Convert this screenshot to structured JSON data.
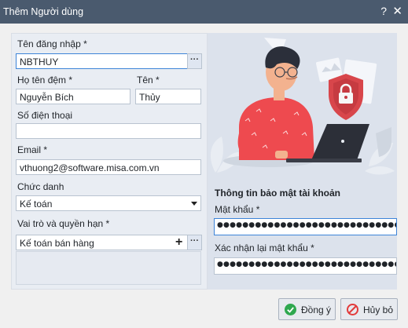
{
  "window": {
    "title": "Thêm Người dùng",
    "help_glyph": "?",
    "close_glyph": "✕"
  },
  "form": {
    "username_label": "Tên đăng nhập *",
    "username_value": "NBTHUY",
    "lastname_label": "Họ tên đệm *",
    "lastname_value": "Nguyễn Bích",
    "firstname_label": "Tên *",
    "firstname_value": "Thủy",
    "phone_label": "Số điện thoại",
    "phone_value": "",
    "email_label": "Email *",
    "email_value": "vthuong2@software.misa.com.vn",
    "title_label": "Chức danh",
    "title_value": "Kế toán",
    "role_label": "Vai trò và quyền hạn *",
    "role_value": "Kế toán bán hàng",
    "dots_glyph": "···",
    "plus_glyph": "+"
  },
  "security": {
    "heading": "Thông tin bảo mật tài khoản",
    "password_label": "Mật khẩu *",
    "password_value": "●●●●●●●●●●●●●●●●●●●●●●●●●●●●●●●",
    "confirm_label": "Xác nhận lại mật khẩu *",
    "confirm_value": "●●●●●●●●●●●●●●●●●●●●●●●●●●●●●●●"
  },
  "buttons": {
    "ok": "Đồng ý",
    "cancel": "Hủy bỏ"
  },
  "colors": {
    "titlebar": "#4a5a6e",
    "shirt": "#ee4a4f",
    "shield": "#d8464b",
    "ok_icon": "#2fa84f",
    "cancel_icon": "#e23b3b"
  }
}
